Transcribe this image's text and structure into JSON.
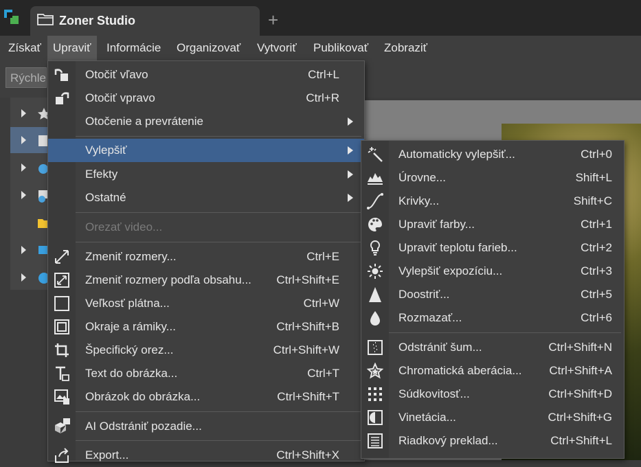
{
  "app": {
    "tab_title": "Zoner Studio",
    "new_tab": "+"
  },
  "menubar": [
    "Získať",
    "Upraviť",
    "Informácie",
    "Organizovať",
    "Vytvoriť",
    "Publikovať",
    "Zobraziť"
  ],
  "toolbar": {
    "quick_label": "Rýchle"
  },
  "edit_menu": {
    "items": [
      {
        "label": "Otočiť vľavo",
        "shortcut": "Ctrl+L",
        "icon": "rotate-left-icon"
      },
      {
        "label": "Otočiť vpravo",
        "shortcut": "Ctrl+R",
        "icon": "rotate-right-icon"
      },
      {
        "label": "Otočenie a prevrátenie",
        "submenu": true
      },
      {
        "label": "Vylepšiť",
        "submenu": true,
        "highlighted": true
      },
      {
        "label": "Efekty",
        "submenu": true
      },
      {
        "label": "Ostatné",
        "submenu": true
      },
      {
        "label": "Orezať video...",
        "disabled": true
      },
      {
        "label": "Zmeniť rozmery...",
        "shortcut": "Ctrl+E",
        "icon": "resize-icon"
      },
      {
        "label": "Zmeniť rozmery podľa obsahu...",
        "shortcut": "Ctrl+Shift+E",
        "icon": "content-aware-resize-icon"
      },
      {
        "label": "Veľkosť plátna...",
        "shortcut": "Ctrl+W",
        "icon": "canvas-size-icon"
      },
      {
        "label": "Okraje a rámiky...",
        "shortcut": "Ctrl+Shift+B",
        "icon": "borders-icon"
      },
      {
        "label": "Špecifický orez...",
        "shortcut": "Ctrl+Shift+W",
        "icon": "crop-icon"
      },
      {
        "label": "Text do obrázka...",
        "shortcut": "Ctrl+T",
        "icon": "text-icon"
      },
      {
        "label": "Obrázok do obrázka...",
        "shortcut": "Ctrl+Shift+T",
        "icon": "picture-in-picture-icon"
      },
      {
        "label": "AI Odstrániť pozadie...",
        "icon": "ai-remove-background-icon"
      },
      {
        "label": "Export...",
        "shortcut": "Ctrl+Shift+X",
        "icon": "export-icon"
      }
    ]
  },
  "enhance_menu": {
    "items": [
      {
        "label": "Automaticky vylepšiť...",
        "shortcut": "Ctrl+0",
        "icon": "magic-wand-icon"
      },
      {
        "label": "Úrovne...",
        "shortcut": "Shift+L",
        "icon": "levels-icon"
      },
      {
        "label": "Krivky...",
        "shortcut": "Shift+C",
        "icon": "curves-icon"
      },
      {
        "label": "Upraviť farby...",
        "shortcut": "Ctrl+1",
        "icon": "palette-icon"
      },
      {
        "label": "Upraviť teplotu farieb...",
        "shortcut": "Ctrl+2",
        "icon": "bulb-icon"
      },
      {
        "label": "Vylepšiť expozíciu...",
        "shortcut": "Ctrl+3",
        "icon": "sun-icon"
      },
      {
        "label": "Doostriť...",
        "shortcut": "Ctrl+5",
        "icon": "sharpen-icon"
      },
      {
        "label": "Rozmazať...",
        "shortcut": "Ctrl+6",
        "icon": "blur-drop-icon"
      },
      {
        "label": "Odstrániť šum...",
        "shortcut": "Ctrl+Shift+N",
        "icon": "noise-icon"
      },
      {
        "label": "Chromatická aberácia...",
        "shortcut": "Ctrl+Shift+A",
        "icon": "chromatic-aberration-icon"
      },
      {
        "label": "Súdkovitosť...",
        "shortcut": "Ctrl+Shift+D",
        "icon": "barrel-distortion-icon"
      },
      {
        "label": "Vinetácia...",
        "shortcut": "Ctrl+Shift+G",
        "icon": "vignette-icon"
      },
      {
        "label": "Riadkový preklad...",
        "shortcut": "Ctrl+Shift+L",
        "icon": "line-translate-icon"
      }
    ]
  }
}
